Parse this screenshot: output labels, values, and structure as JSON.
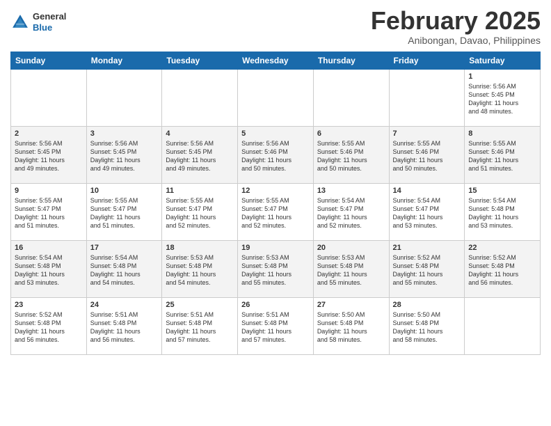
{
  "header": {
    "logo": {
      "general": "General",
      "blue": "Blue"
    },
    "title": "February 2025",
    "location": "Anibongan, Davao, Philippines"
  },
  "weekdays": [
    "Sunday",
    "Monday",
    "Tuesday",
    "Wednesday",
    "Thursday",
    "Friday",
    "Saturday"
  ],
  "weeks": [
    [
      {
        "day": "",
        "info": ""
      },
      {
        "day": "",
        "info": ""
      },
      {
        "day": "",
        "info": ""
      },
      {
        "day": "",
        "info": ""
      },
      {
        "day": "",
        "info": ""
      },
      {
        "day": "",
        "info": ""
      },
      {
        "day": "1",
        "info": "Sunrise: 5:56 AM\nSunset: 5:45 PM\nDaylight: 11 hours\nand 48 minutes."
      }
    ],
    [
      {
        "day": "2",
        "info": "Sunrise: 5:56 AM\nSunset: 5:45 PM\nDaylight: 11 hours\nand 49 minutes."
      },
      {
        "day": "3",
        "info": "Sunrise: 5:56 AM\nSunset: 5:45 PM\nDaylight: 11 hours\nand 49 minutes."
      },
      {
        "day": "4",
        "info": "Sunrise: 5:56 AM\nSunset: 5:45 PM\nDaylight: 11 hours\nand 49 minutes."
      },
      {
        "day": "5",
        "info": "Sunrise: 5:56 AM\nSunset: 5:46 PM\nDaylight: 11 hours\nand 50 minutes."
      },
      {
        "day": "6",
        "info": "Sunrise: 5:55 AM\nSunset: 5:46 PM\nDaylight: 11 hours\nand 50 minutes."
      },
      {
        "day": "7",
        "info": "Sunrise: 5:55 AM\nSunset: 5:46 PM\nDaylight: 11 hours\nand 50 minutes."
      },
      {
        "day": "8",
        "info": "Sunrise: 5:55 AM\nSunset: 5:46 PM\nDaylight: 11 hours\nand 51 minutes."
      }
    ],
    [
      {
        "day": "9",
        "info": "Sunrise: 5:55 AM\nSunset: 5:47 PM\nDaylight: 11 hours\nand 51 minutes."
      },
      {
        "day": "10",
        "info": "Sunrise: 5:55 AM\nSunset: 5:47 PM\nDaylight: 11 hours\nand 51 minutes."
      },
      {
        "day": "11",
        "info": "Sunrise: 5:55 AM\nSunset: 5:47 PM\nDaylight: 11 hours\nand 52 minutes."
      },
      {
        "day": "12",
        "info": "Sunrise: 5:55 AM\nSunset: 5:47 PM\nDaylight: 11 hours\nand 52 minutes."
      },
      {
        "day": "13",
        "info": "Sunrise: 5:54 AM\nSunset: 5:47 PM\nDaylight: 11 hours\nand 52 minutes."
      },
      {
        "day": "14",
        "info": "Sunrise: 5:54 AM\nSunset: 5:47 PM\nDaylight: 11 hours\nand 53 minutes."
      },
      {
        "day": "15",
        "info": "Sunrise: 5:54 AM\nSunset: 5:48 PM\nDaylight: 11 hours\nand 53 minutes."
      }
    ],
    [
      {
        "day": "16",
        "info": "Sunrise: 5:54 AM\nSunset: 5:48 PM\nDaylight: 11 hours\nand 53 minutes."
      },
      {
        "day": "17",
        "info": "Sunrise: 5:54 AM\nSunset: 5:48 PM\nDaylight: 11 hours\nand 54 minutes."
      },
      {
        "day": "18",
        "info": "Sunrise: 5:53 AM\nSunset: 5:48 PM\nDaylight: 11 hours\nand 54 minutes."
      },
      {
        "day": "19",
        "info": "Sunrise: 5:53 AM\nSunset: 5:48 PM\nDaylight: 11 hours\nand 55 minutes."
      },
      {
        "day": "20",
        "info": "Sunrise: 5:53 AM\nSunset: 5:48 PM\nDaylight: 11 hours\nand 55 minutes."
      },
      {
        "day": "21",
        "info": "Sunrise: 5:52 AM\nSunset: 5:48 PM\nDaylight: 11 hours\nand 55 minutes."
      },
      {
        "day": "22",
        "info": "Sunrise: 5:52 AM\nSunset: 5:48 PM\nDaylight: 11 hours\nand 56 minutes."
      }
    ],
    [
      {
        "day": "23",
        "info": "Sunrise: 5:52 AM\nSunset: 5:48 PM\nDaylight: 11 hours\nand 56 minutes."
      },
      {
        "day": "24",
        "info": "Sunrise: 5:51 AM\nSunset: 5:48 PM\nDaylight: 11 hours\nand 56 minutes."
      },
      {
        "day": "25",
        "info": "Sunrise: 5:51 AM\nSunset: 5:48 PM\nDaylight: 11 hours\nand 57 minutes."
      },
      {
        "day": "26",
        "info": "Sunrise: 5:51 AM\nSunset: 5:48 PM\nDaylight: 11 hours\nand 57 minutes."
      },
      {
        "day": "27",
        "info": "Sunrise: 5:50 AM\nSunset: 5:48 PM\nDaylight: 11 hours\nand 58 minutes."
      },
      {
        "day": "28",
        "info": "Sunrise: 5:50 AM\nSunset: 5:48 PM\nDaylight: 11 hours\nand 58 minutes."
      },
      {
        "day": "",
        "info": ""
      }
    ]
  ]
}
